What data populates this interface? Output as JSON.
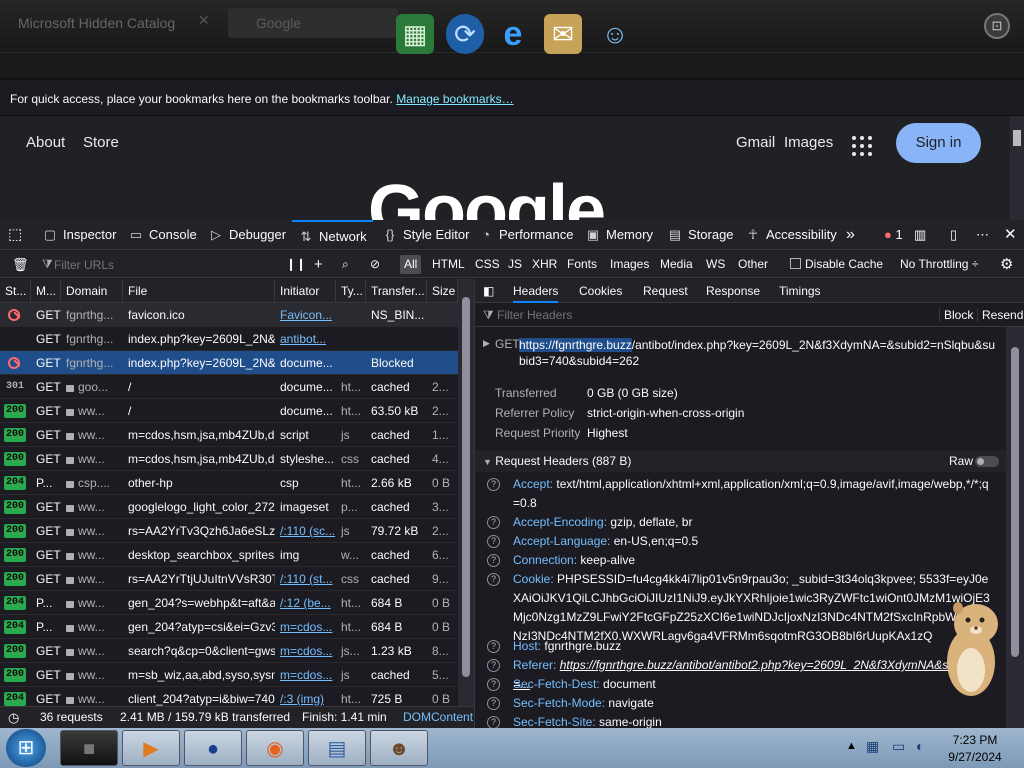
{
  "browser": {
    "tab_title": "Microsoft Hidden Catalog",
    "search_placeholder": "Google",
    "profile_icon": "toolbox-icon",
    "dock_icons": [
      "winrar-icon",
      "windows-update-icon",
      "internet-explorer-icon",
      "mail-icon",
      "users-icon"
    ]
  },
  "bookmarks_bar": {
    "text": "For quick access, place your bookmarks here on the bookmarks toolbar. ",
    "link": "Manage bookmarks…"
  },
  "google_page": {
    "about": "About",
    "store": "Store",
    "gmail": "Gmail",
    "images": "Images",
    "signin": "Sign in",
    "logo": "Google"
  },
  "devtools_tabs": [
    {
      "label": "Inspector",
      "icon": "inspector-icon"
    },
    {
      "label": "Console",
      "icon": "console-icon"
    },
    {
      "label": "Debugger",
      "icon": "debugger-icon"
    },
    {
      "label": "Network",
      "icon": "network-icon"
    },
    {
      "label": "Style Editor",
      "icon": "style-editor-icon"
    },
    {
      "label": "Performance",
      "icon": "performance-icon"
    },
    {
      "label": "Memory",
      "icon": "memory-icon"
    },
    {
      "label": "Storage",
      "icon": "storage-icon"
    },
    {
      "label": "Accessibility",
      "icon": "accessibility-icon"
    }
  ],
  "error_count": "1",
  "filter": {
    "placeholder": "Filter URLs",
    "types": [
      "All",
      "HTML",
      "CSS",
      "JS",
      "XHR",
      "Fonts",
      "Images",
      "Media",
      "WS",
      "Other"
    ],
    "disable_cache": "Disable Cache",
    "throttling": "No Throttling ÷"
  },
  "columns": [
    "St...",
    "M...",
    "Domain",
    "File",
    "Initiator",
    "Ty...",
    "Transfer...",
    "Size"
  ],
  "requests": [
    {
      "status": "block",
      "method": "GET",
      "domain": "fgnrthg...",
      "file": "favicon.ico",
      "initiator": "Favicon...",
      "type": "",
      "transferred": "NS_BIN...",
      "size": "",
      "lock": false,
      "init_link": true
    },
    {
      "status": "none",
      "method": "GET",
      "domain": "fgnrthg...",
      "file": "index.php?key=2609L_2N&f3",
      "initiator": "antibot...",
      "type": "",
      "transferred": "",
      "size": "",
      "lock": false,
      "init_link": true
    },
    {
      "status": "block",
      "method": "GET",
      "domain": "fgnrthg...",
      "file": "index.php?key=2609L_2N&f3",
      "initiator": "docume...",
      "type": "",
      "transferred": "Blocked",
      "size": "",
      "lock": false,
      "init_link": false
    },
    {
      "status": "301",
      "method": "GET",
      "domain": "goo...",
      "file": "/",
      "initiator": "docume...",
      "type": "ht...",
      "transferred": "cached",
      "size": "2...",
      "lock": true,
      "init_link": false
    },
    {
      "status": "200",
      "method": "GET",
      "domain": "ww...",
      "file": "/",
      "initiator": "docume...",
      "type": "ht...",
      "transferred": "63.50 kB",
      "size": "2...",
      "lock": true,
      "init_link": false
    },
    {
      "status": "200",
      "method": "GET",
      "domain": "ww...",
      "file": "m=cdos,hsm,jsa,mb4ZUb,d,c",
      "initiator": "script",
      "type": "js",
      "transferred": "cached",
      "size": "1...",
      "lock": true,
      "init_link": false
    },
    {
      "status": "200",
      "method": "GET",
      "domain": "ww...",
      "file": "m=cdos,hsm,jsa,mb4ZUb,d,c",
      "initiator": "styleshe...",
      "type": "css",
      "transferred": "cached",
      "size": "4...",
      "lock": true,
      "init_link": false
    },
    {
      "status": "204",
      "method": "P...",
      "domain": "csp....",
      "file": "other-hp",
      "initiator": "csp",
      "type": "ht...",
      "transferred": "2.66 kB",
      "size": "0 B",
      "lock": true,
      "init_link": false
    },
    {
      "status": "200",
      "method": "GET",
      "domain": "ww...",
      "file": "googlelogo_light_color_272x",
      "initiator": "imageset",
      "type": "p...",
      "transferred": "cached",
      "size": "3...",
      "lock": true,
      "init_link": false
    },
    {
      "status": "200",
      "method": "GET",
      "domain": "ww...",
      "file": "rs=AA2YrTv3Qzh6Ja6eSLzWU_",
      "initiator": "/:110 (sc...",
      "type": "js",
      "transferred": "79.72 kB",
      "size": "2...",
      "lock": true,
      "init_link": true
    },
    {
      "status": "200",
      "method": "GET",
      "domain": "ww...",
      "file": "desktop_searchbox_sprites3",
      "initiator": "img",
      "type": "w...",
      "transferred": "cached",
      "size": "6...",
      "lock": true,
      "init_link": false
    },
    {
      "status": "200",
      "method": "GET",
      "domain": "ww...",
      "file": "rs=AA2YrTtjUJuItnVVsR30T6",
      "initiator": "/:110 (st...",
      "type": "css",
      "transferred": "cached",
      "size": "9...",
      "lock": true,
      "init_link": true
    },
    {
      "status": "204",
      "method": "P...",
      "domain": "ww...",
      "file": "gen_204?s=webhp&t=aft&a",
      "initiator": "/:12 (be...",
      "type": "ht...",
      "transferred": "684 B",
      "size": "0 B",
      "lock": true,
      "init_link": true
    },
    {
      "status": "204",
      "method": "P...",
      "domain": "ww...",
      "file": "gen_204?atyp=csi&ei=Gzv3Z",
      "initiator": "m=cdos...",
      "type": "ht...",
      "transferred": "684 B",
      "size": "0 B",
      "lock": true,
      "init_link": true
    },
    {
      "status": "200",
      "method": "GET",
      "domain": "ww...",
      "file": "search?q&cp=0&client=gws",
      "initiator": "m=cdos...",
      "type": "js...",
      "transferred": "1.23 kB",
      "size": "8...",
      "lock": true,
      "init_link": true
    },
    {
      "status": "200",
      "method": "GET",
      "domain": "ww...",
      "file": "m=sb_wiz,aa,abd,syso,sysn,s",
      "initiator": "m=cdos...",
      "type": "js",
      "transferred": "cached",
      "size": "5...",
      "lock": true,
      "init_link": true
    },
    {
      "status": "204",
      "method": "GET",
      "domain": "ww...",
      "file": "client_204?atyp=i&biw=740&",
      "initiator": "/:3 (img)",
      "type": "ht...",
      "transferred": "725 B",
      "size": "0 B",
      "lock": true,
      "init_link": true
    }
  ],
  "footer": {
    "requests": "36 requests",
    "transferred": "2.41 MB / 159.79 kB transferred",
    "finish": "Finish: 1.41 min",
    "dom": "DOMContent"
  },
  "detail_tabs": [
    "Headers",
    "Cookies",
    "Request",
    "Response",
    "Timings"
  ],
  "detail": {
    "filter_placeholder": "Filter Headers",
    "block": "Block",
    "resend": "Resend",
    "request_method": "GET",
    "url_host": "https://fgnrthgre.buzz",
    "url_rest": "/antibot/index.php?key=2609L_2N&f3XdymNA=&subid2=nSlqbu&subid3=740&subid4=262",
    "transferred_label": "Transferred",
    "transferred_value": "0 GB (0 GB size)",
    "referrer_label": "Referrer Policy",
    "referrer_value": "strict-origin-when-cross-origin",
    "priority_label": "Request Priority",
    "priority_value": "Highest",
    "request_headers_title": "Request Headers (887 B)",
    "raw": "Raw"
  },
  "request_headers": [
    {
      "name": "Accept:",
      "value": "text/html,application/xhtml+xml,application/xml;q=0.9,image/avif,image/webp,*/*;q=0.8"
    },
    {
      "name": "Accept-Encoding:",
      "value": "gzip, deflate, br"
    },
    {
      "name": "Accept-Language:",
      "value": "en-US,en;q=0.5"
    },
    {
      "name": "Connection:",
      "value": "keep-alive"
    },
    {
      "name": "Cookie:",
      "value": "PHPSESSID=fu4cg4kk4i7lip01v5n9rpau3o; _subid=3t34olq3kpvee; 5533f=eyJ0eXAiOiJKV1QiLCJhbGciOiJIUzI1NiJ9.eyJkYXRhIjoie1wic3RyZWFtc1wiOnt0JMzM1wiOjE3Mjc0Nzg1MzZ9LFwiY2FtcGFpZ25zXCI6e1wiNDJcIjoxNzI3NDc4NTM2fSxcInRpbWVcIjoxNzI3NDc4NTM2fX0.WXWRLagv6ga4VFRMm6sqotmRG3OB8bI6rUupKAx1zQ"
    },
    {
      "name": "Host:",
      "value": "fgnrthgre.buzz"
    },
    {
      "name": "Referer:",
      "value": "https://fgnrthgre.buzz/antibot/antibot2.php?key=2609L_2N&f3XdymNA&subid2=..."
    },
    {
      "name": "Sec-Fetch-Dest:",
      "value": "document"
    },
    {
      "name": "Sec-Fetch-Mode:",
      "value": "navigate"
    },
    {
      "name": "Sec-Fetch-Site:",
      "value": "same-origin"
    }
  ],
  "taskbar": {
    "apps": [
      "black-box-app-icon",
      "media-player-icon",
      "world-icon",
      "firefox-icon",
      "notepad-icon",
      "contact-app-icon"
    ],
    "time": "7:23 PM",
    "date": "9/27/2024"
  }
}
